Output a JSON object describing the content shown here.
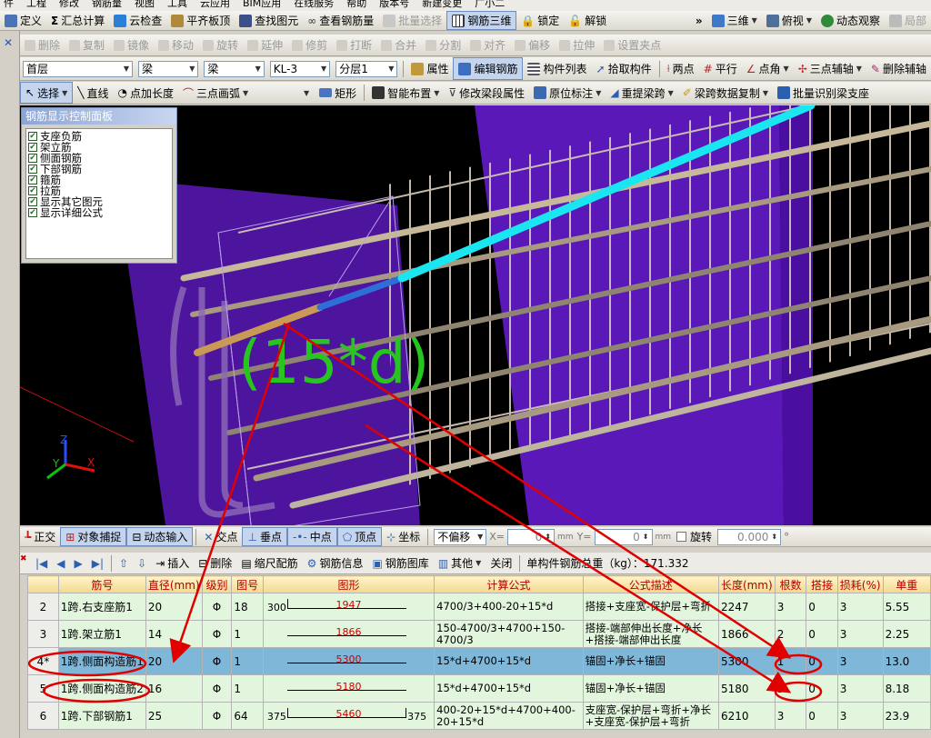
{
  "menubar": [
    "件",
    "工程",
    "修改",
    "钢筋量",
    "视图",
    "工具",
    "云应用",
    "BIM应用",
    "在线服务",
    "帮助",
    "版本号",
    "新建变更",
    "广小二"
  ],
  "toolbar1": {
    "items": [
      "定义",
      "汇总计算",
      "云检查",
      "平齐板顶",
      "查找图元",
      "查看钢筋量",
      "批量选择",
      "钢筋三维",
      "锁定",
      "解锁"
    ],
    "view3d": "三维",
    "view_top": "俯视",
    "dynamic": "动态观察",
    "local": "局部"
  },
  "toolbar2": [
    "删除",
    "复制",
    "镜像",
    "移动",
    "旋转",
    "延伸",
    "修剪",
    "打断",
    "合并",
    "分割",
    "对齐",
    "偏移",
    "拉伸",
    "设置夹点"
  ],
  "toolbar3": {
    "floor": "首层",
    "type1": "梁",
    "type2": "梁",
    "member": "KL-3",
    "layer": "分层1",
    "buttons": [
      "属性",
      "编辑钢筋",
      "构件列表",
      "拾取构件",
      "两点",
      "平行",
      "点角",
      "三点辅轴",
      "删除辅轴"
    ]
  },
  "toolbar4": [
    "选择",
    "直线",
    "点加长度",
    "三点画弧",
    "矩形",
    "智能布置",
    "修改梁段属性",
    "原位标注",
    "重提梁跨",
    "梁跨数据复制",
    "批量识别梁支座"
  ],
  "panel": {
    "title": "钢筋显示控制面板",
    "items": [
      "支座负筋",
      "架立筋",
      "侧面钢筋",
      "下部钢筋",
      "箍筋",
      "拉筋",
      "显示其它图元",
      "显示详细公式"
    ]
  },
  "viewport": {
    "formula_label": "(15*d)"
  },
  "snapbar": {
    "items": [
      "正交",
      "对象捕捉",
      "动态输入",
      "交点",
      "垂点",
      "中点",
      "顶点",
      "坐标"
    ],
    "mode": "不偏移",
    "x_label": "X=",
    "x_value": "0",
    "y_label": "Y=",
    "y_value": "0",
    "unit": "mm",
    "rotate_label": "旋转",
    "rotate_value": "0.000",
    "degree": "°"
  },
  "editbar": {
    "items": [
      "插入",
      "删除",
      "缩尺配筋",
      "钢筋信息",
      "钢筋图库",
      "其他",
      "关闭"
    ],
    "weight_label": "单构件钢筋总重（kg）：171.332"
  },
  "table": {
    "headers": [
      "筋号",
      "直径(mm)",
      "级别",
      "图号",
      "图形",
      "计算公式",
      "公式描述",
      "长度(mm)",
      "根数",
      "搭接",
      "损耗(%)",
      "单重"
    ],
    "rows": [
      {
        "num": "2",
        "name": "1跨.右支座筋1",
        "dia": "20",
        "grade": "Φ",
        "fig": "18",
        "shape_left": "300",
        "shape_mid": "1947",
        "shape_right": "",
        "formula": "4700/3+400-20+15*d",
        "desc": "搭接+支座宽-保护层+弯折",
        "length": "2247",
        "count": "3",
        "lap": "0",
        "loss": "3",
        "unitw": "5.55"
      },
      {
        "num": "3",
        "name": "1跨.架立筋1",
        "dia": "14",
        "grade": "Φ",
        "fig": "1",
        "shape_left": "",
        "shape_mid": "1866",
        "shape_right": "",
        "formula": "150-4700/3+4700+150-4700/3",
        "desc": "搭接-端部伸出长度+净长+搭接-端部伸出长度",
        "length": "1866",
        "count": "2",
        "lap": "0",
        "loss": "3",
        "unitw": "2.25"
      },
      {
        "num": "4*",
        "name": "1跨.侧面构造筋1",
        "dia": "20",
        "grade": "Φ",
        "fig": "1",
        "shape_left": "",
        "shape_mid": "5300",
        "shape_right": "",
        "formula": "15*d+4700+15*d",
        "desc": "锚固+净长+锚固",
        "length": "5300",
        "count": "1",
        "lap": "0",
        "loss": "3",
        "unitw": "13.0"
      },
      {
        "num": "5",
        "name": "1跨.侧面构造筋2",
        "dia": "16",
        "grade": "Φ",
        "fig": "1",
        "shape_left": "",
        "shape_mid": "5180",
        "shape_right": "",
        "formula": "15*d+4700+15*d",
        "desc": "锚固+净长+锚固",
        "length": "5180",
        "count": "3",
        "lap": "0",
        "loss": "3",
        "unitw": "8.18"
      },
      {
        "num": "6",
        "name": "1跨.下部钢筋1",
        "dia": "25",
        "grade": "Φ",
        "fig": "64",
        "shape_left": "375",
        "shape_mid": "5460",
        "shape_right": "375",
        "formula": "400-20+15*d+4700+400-20+15*d",
        "desc": "支座宽-保护层+弯折+净长+支座宽-保护层+弯折",
        "length": "6210",
        "count": "3",
        "lap": "0",
        "loss": "3",
        "unitw": "23.9"
      }
    ]
  },
  "colors": {
    "accent": "#d00000",
    "header_bg": "#f2d98f",
    "row_bg": "#e2f5dd",
    "selected_bg": "#7fb7d9",
    "purple": "#5a18b8",
    "cyan": "#19e6f0",
    "green": "#27c61e"
  }
}
